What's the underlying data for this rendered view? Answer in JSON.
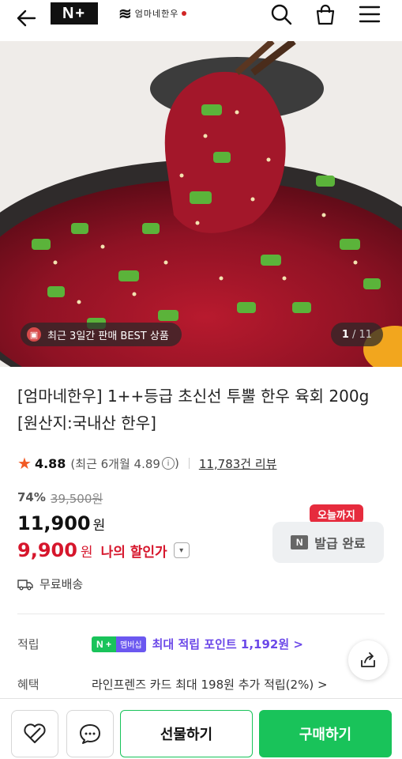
{
  "header": {
    "np_badge": "N+",
    "brand_logo_text": "엄마네한우"
  },
  "hero": {
    "best_label": "최근 3일간 판매 BEST 상품",
    "counter_current": "1",
    "counter_total": "/ 11"
  },
  "product": {
    "title": "[엄마네한우] 1++등급 초신선 투뿔 한우 육회 200g [원산지:국내산 한우]",
    "rating": "4.88",
    "rating_recent": "(최근 6개월 4.89",
    "rating_recent_close": ")",
    "reviews": "11,783건 리뷰",
    "discount_pct": "74%",
    "original_price": "39,500원",
    "price": "11,900",
    "price_unit": "원",
    "my_price": "9,900",
    "my_price_unit": "원",
    "my_price_label": "나의 할인가",
    "today_tag": "오늘까지",
    "coupon_label": "발급 완료",
    "coupon_icon": "N",
    "shipping": "무료배송"
  },
  "points": {
    "label": "적립",
    "np": "N +",
    "membership": "멤버십",
    "text": "최대 적립 포인트 1,192원 >"
  },
  "benefit": {
    "label": "혜택",
    "text": "라인프렌즈 카드 최대 198원 추가 적립(2%) >"
  },
  "bottom": {
    "gift_label": "선물하기",
    "buy_label": "구매하기"
  },
  "colors": {
    "brand_green": "#19c35a",
    "sale_red": "#d6162c",
    "point_purple": "#6b48e8",
    "star_orange": "#f15a24"
  }
}
